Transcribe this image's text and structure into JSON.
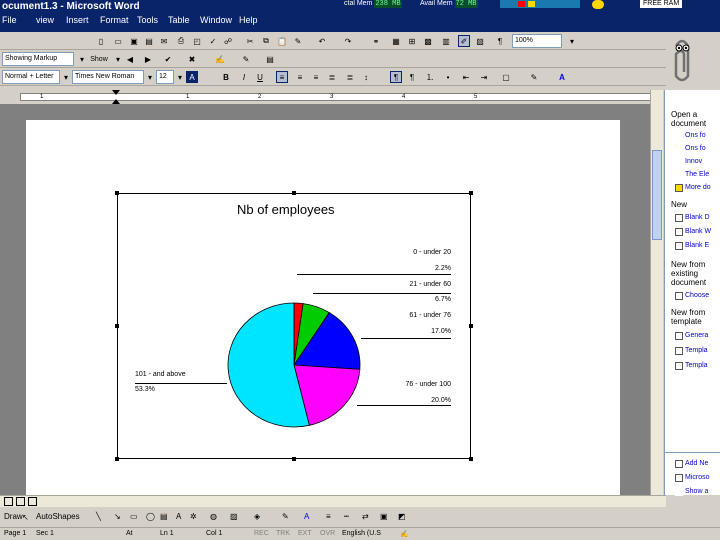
{
  "window": {
    "title": "ocument1.3 - Microsoft Word"
  },
  "menu": [
    "File",
    "view",
    "Insert",
    "Format",
    "Tools",
    "Table",
    "Window",
    "Help"
  ],
  "topstatus": {
    "total_mem_label": "ctal Mem",
    "total_mem_value": "238 MB",
    "avail_mem_label": "Avail Mem",
    "avail_mem_value": "72 MB",
    "badge": "FREE RAM"
  },
  "toolbar": {
    "markup_combo": "Showing Markup",
    "show_label": "Show",
    "style_combo": "Normal + Letter",
    "font_combo": "Times New Roman",
    "size_combo": "12",
    "zoom_combo": "100%",
    "bold": "B",
    "italic": "I",
    "underline": "U"
  },
  "ruler": {
    "numbers": [
      "1",
      "1",
      "2",
      "3",
      "4",
      "5"
    ]
  },
  "chart_data": {
    "type": "pie",
    "title": "Nb of employees",
    "slices": [
      {
        "label": "0 - under 20",
        "value": 2.2,
        "display": "2.2%",
        "color": "#ff0000"
      },
      {
        "label": "21 - under 60",
        "value": 6.7,
        "display": "6.7%",
        "color": "#00cc00"
      },
      {
        "label": "61 - under 76",
        "value": 17.0,
        "display": "17.0%",
        "color": "#0000ff"
      },
      {
        "label": "76 - under 100",
        "value": 20.0,
        "display": "20.0%",
        "color": "#ff00ff"
      },
      {
        "label": "101 - and above",
        "value": 53.3,
        "display": "53.3%",
        "color": "#00e5ff"
      }
    ]
  },
  "taskpane": {
    "open_heading": "Open a document",
    "open_links": [
      "Ons fo",
      "Ons fo",
      "Innov",
      "The Ele"
    ],
    "more_docs": "More do",
    "new_heading": "New",
    "new_links": [
      "Blank D",
      "Blank W",
      "Blank E"
    ],
    "new_existing_heading": "New from existing document",
    "choose_doc": "Choose",
    "new_template_heading": "New from template",
    "template_links": [
      "Genera",
      "Templa",
      "Templa"
    ],
    "footer_links": [
      "Add Ne",
      "Microso",
      "Show a"
    ]
  },
  "drawbar": {
    "draw_label": "Draw",
    "autoshapes_label": "AutoShapes"
  },
  "statusbar": {
    "page": "Page 1",
    "sec": "Sec 1",
    "at": "At",
    "ln": "Ln 1",
    "col": "Col 1",
    "rec": "REC",
    "trk": "TRK",
    "ext": "EXT",
    "ovr": "OVR",
    "lang": "English (U.S"
  }
}
